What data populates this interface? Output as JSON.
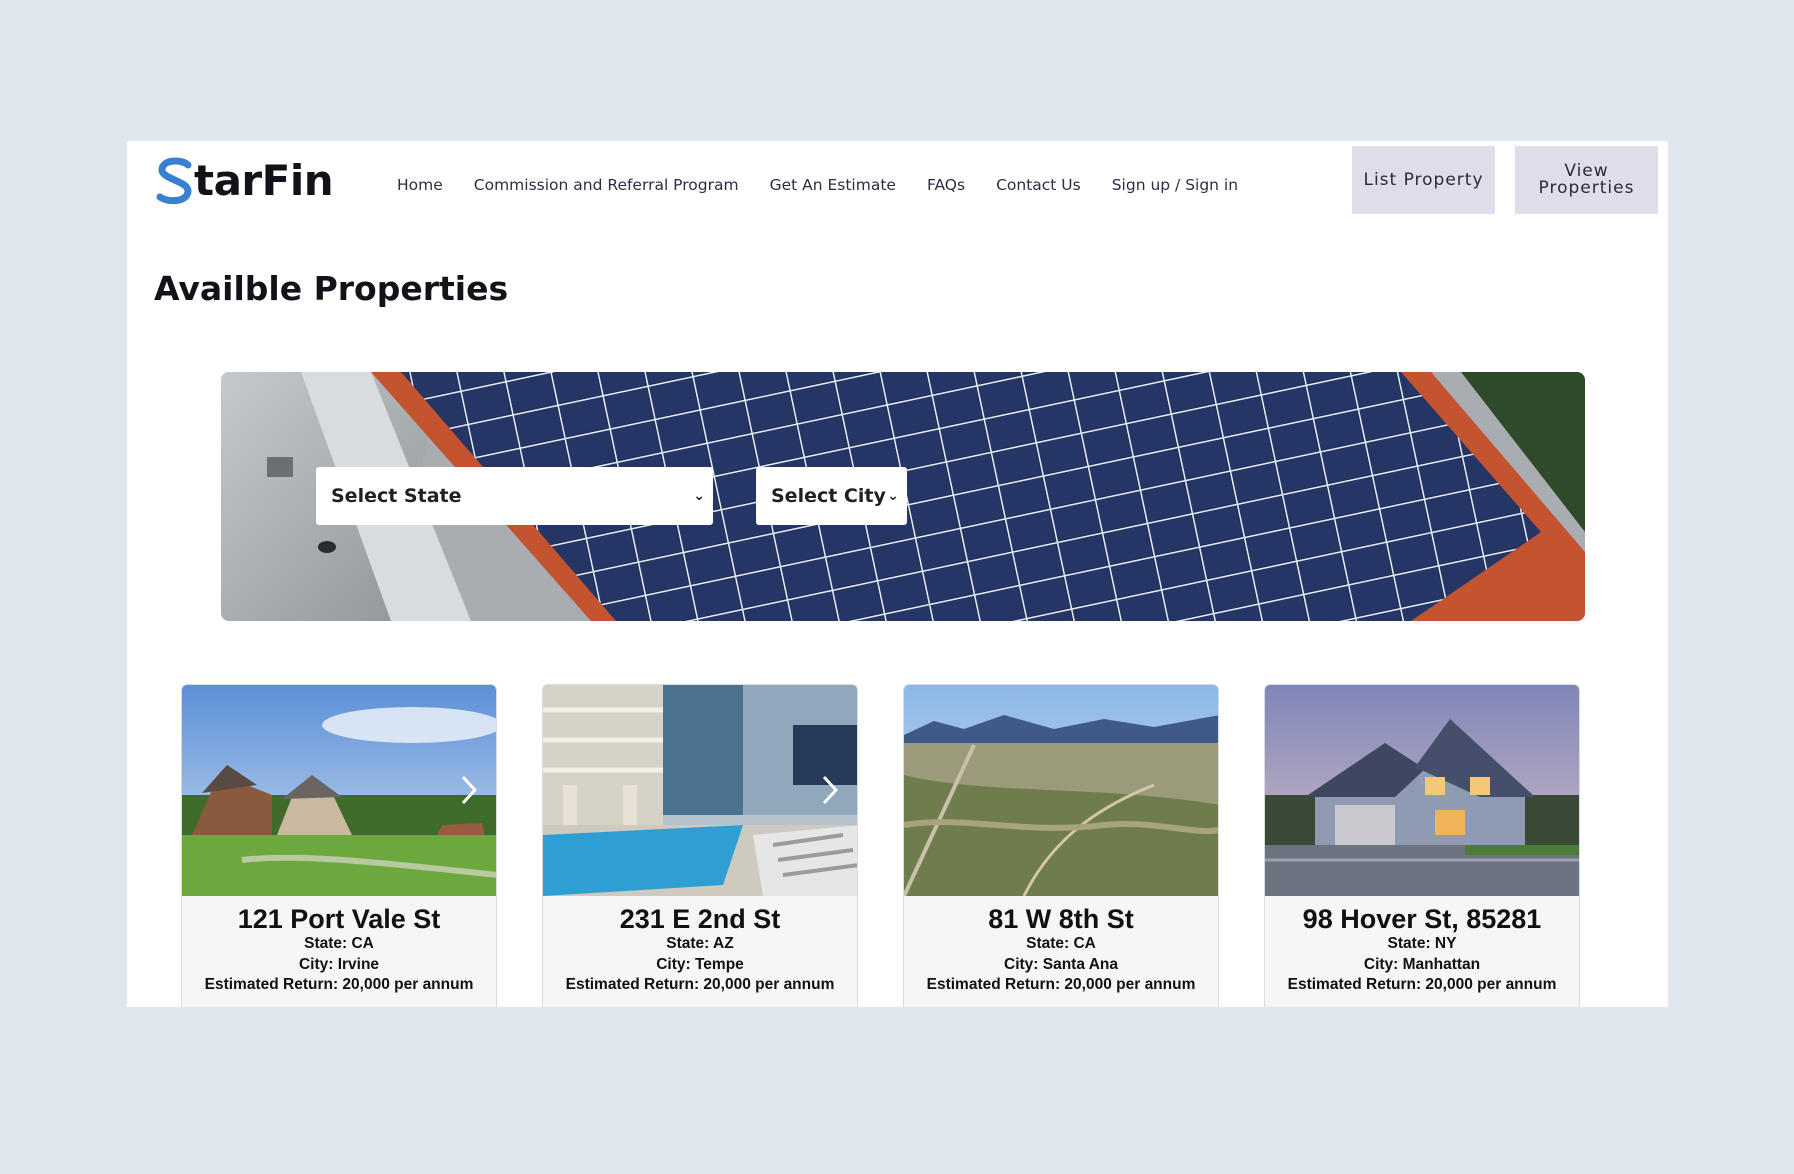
{
  "brand": {
    "logo_mark": "S",
    "logo_text": "tarFin"
  },
  "nav": {
    "items": [
      {
        "label": "Home"
      },
      {
        "label": "Commission and Referral Program"
      },
      {
        "label": "Get An Estimate"
      },
      {
        "label": "FAQs"
      },
      {
        "label": "Contact Us"
      },
      {
        "label": "Sign up / Sign in"
      }
    ]
  },
  "header_buttons": {
    "list_property": "List Property",
    "view_properties": "View\nProperties"
  },
  "page_title": "Availble Properties",
  "filters": {
    "state": {
      "value": "Select State"
    },
    "city": {
      "value": "Select City"
    }
  },
  "properties": [
    {
      "title": "121 Port Vale St",
      "state": "State: CA",
      "city": "City: Irvine",
      "return": "Estimated Return: 20,000 per annum",
      "image": "suburban-homes"
    },
    {
      "title": "231 E 2nd St",
      "state": "State: AZ",
      "city": "City: Tempe",
      "return": "Estimated Return: 20,000 per annum",
      "image": "pool-apartment"
    },
    {
      "title": "81 W 8th St",
      "state": "State: CA",
      "city": "City: Santa Ana",
      "return": "Estimated Return: 20,000 per annum",
      "image": "desert-land"
    },
    {
      "title": "98 Hover St, 85281",
      "state": "State: NY",
      "city": "City: Manhattan",
      "return": "Estimated Return: 20,000 per annum",
      "image": "modern-house"
    }
  ],
  "colors": {
    "background": "#e1e7ef",
    "brand_blue": "#3b7fd1",
    "button_bg": "#dfdde9",
    "card_bg": "#f5f6f6"
  },
  "icons": {
    "carousel_next": "chevron-right-icon",
    "select_caret": "chevron-down-icon"
  }
}
